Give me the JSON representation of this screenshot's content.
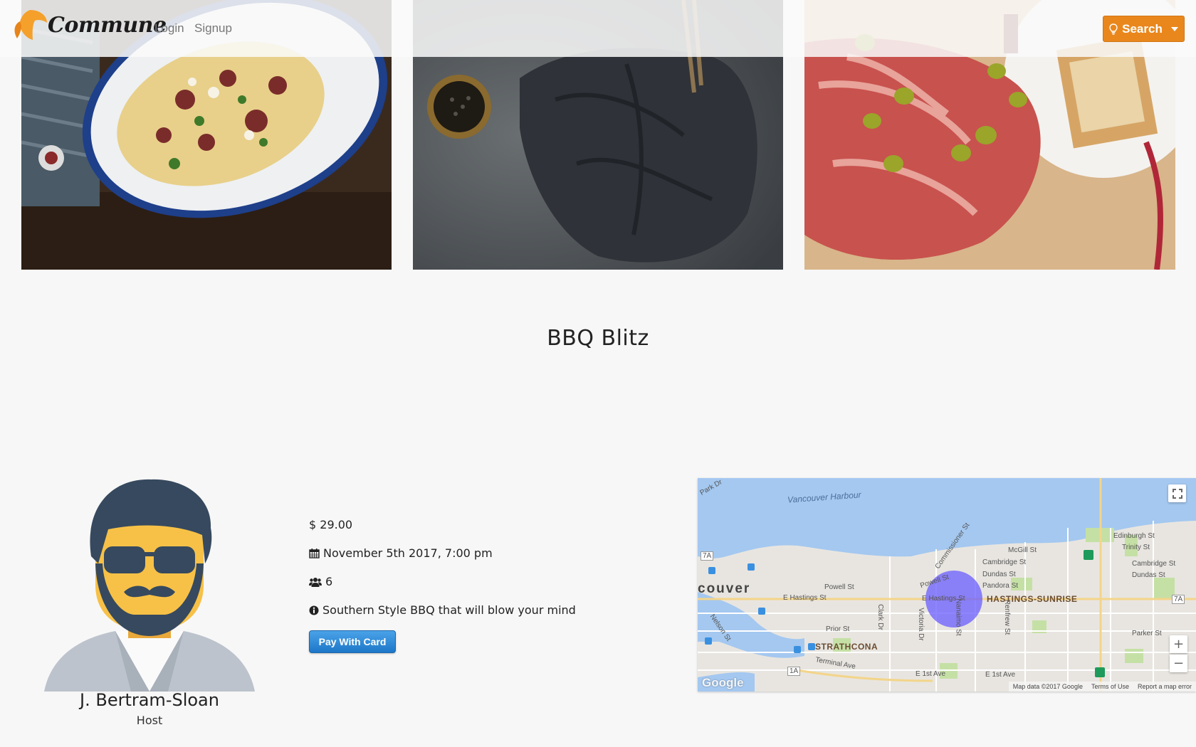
{
  "navbar": {
    "brand": "Commune",
    "login": "Login",
    "signup": "Signup",
    "search_label": "Search"
  },
  "event": {
    "title": "BBQ Blitz",
    "price": "$ 29.00",
    "date": "November 5th 2017, 7:00 pm",
    "guests": "6",
    "description": "Southern Style BBQ that will blow your mind",
    "pay_button": "Pay With Card"
  },
  "host": {
    "name": "J. Bertram-Sloan",
    "role": "Host"
  },
  "map": {
    "labels": {
      "harbour": "Vancouver Harbour",
      "city": "couver",
      "powell1": "Powell St",
      "powell2": "Powell St",
      "e_hastings1": "E Hastings St",
      "e_hastings2": "E Hastings St",
      "hastings_sunrise": "HASTINGS-SUNRISE",
      "strathcona": "STRATHCONA",
      "prior": "Prior St",
      "terminal": "Terminal Ave",
      "mcgill": "McGill St",
      "cambridge1": "Cambridge St",
      "cambridge2": "Cambridge St",
      "dundas1": "Dundas St",
      "dundas2": "Dundas St",
      "pandora": "Pandora St",
      "edinburgh": "Edinburgh St",
      "trinity": "Trinity St",
      "parker": "Parker St",
      "e1st1": "E 1st Ave",
      "e1st2": "E 1st Ave",
      "clark": "Clark Dr",
      "victoria": "Victoria Dr",
      "nanaimo": "Nanaimo St",
      "renfrew": "Renfrew St",
      "commissioner": "Commissioner St",
      "nelson": "Nelson St",
      "park": "Park Dr",
      "route7a1": "7A",
      "route7a2": "7A",
      "route1a": "1A"
    },
    "footer": {
      "data": "Map data ©2017 Google",
      "terms": "Terms of Use",
      "report": "Report a map error"
    },
    "google": "Google",
    "colors": {
      "water": "#a4c8f0",
      "land": "#e8e5e0",
      "park": "#c5e0a5",
      "marker": "#6a5cff"
    }
  },
  "colors": {
    "accent": "#e9871d",
    "pay_button": "#1d77c8",
    "background": "#f7f7f7"
  },
  "icons": {
    "search": "lightbulb-icon",
    "date": "calendar-icon",
    "guests": "users-icon",
    "description": "info-circle-icon"
  }
}
